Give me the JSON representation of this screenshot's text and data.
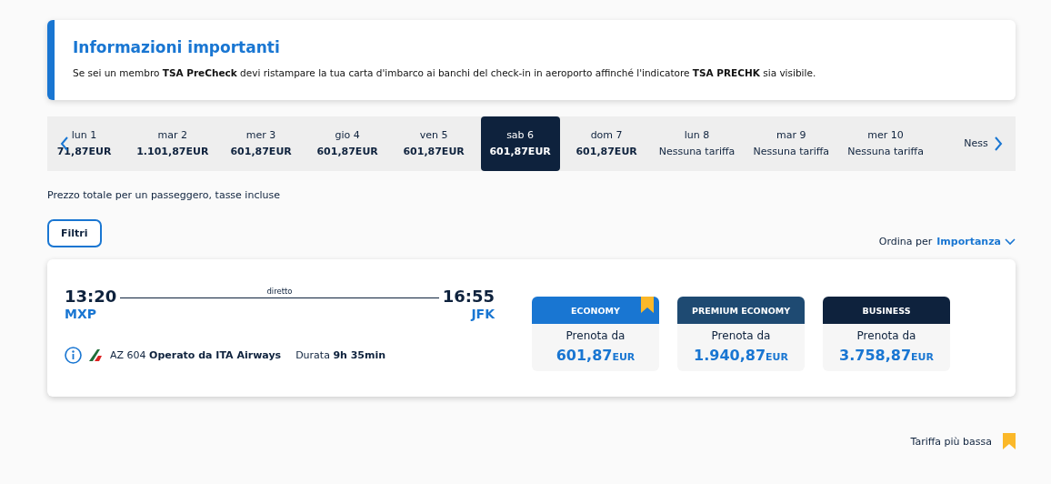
{
  "notice": {
    "title": "Informazioni importanti",
    "text": "Se sei un membro **TSA PreCheck** devi ristampare la tua carta d'imbarco ai banchi del check-in in aeroporto affinché l'indicatore **TSA PRECHK** sia visibile."
  },
  "dates": [
    {
      "day": "lun 1",
      "price": "71,87EUR",
      "kind": "fare",
      "selected": false
    },
    {
      "day": "mar 2",
      "price": "1.101,87EUR",
      "kind": "fare",
      "selected": false
    },
    {
      "day": "mer 3",
      "price": "601,87EUR",
      "kind": "fare",
      "selected": false
    },
    {
      "day": "gio 4",
      "price": "601,87EUR",
      "kind": "fare",
      "selected": false
    },
    {
      "day": "ven 5",
      "price": "601,87EUR",
      "kind": "fare",
      "selected": false
    },
    {
      "day": "sab 6",
      "price": "601,87EUR",
      "kind": "fare",
      "selected": true
    },
    {
      "day": "dom 7",
      "price": "601,87EUR",
      "kind": "fare",
      "selected": false
    },
    {
      "day": "lun 8",
      "price": "Nessuna tariffa",
      "kind": "none",
      "selected": false
    },
    {
      "day": "mar 9",
      "price": "Nessuna tariffa",
      "kind": "none",
      "selected": false
    },
    {
      "day": "mer 10",
      "price": "Nessuna tariffa",
      "kind": "none",
      "selected": false
    },
    {
      "price": "Ness",
      "kind": "none",
      "selected": false
    }
  ],
  "price_note": "Prezzo totale per un passeggero, tasse incluse",
  "filter_button": "Filtri",
  "sort": {
    "label": "Ordina per",
    "value": "Importanza"
  },
  "flight": {
    "departure_time": "13:20",
    "departure_airport": "MXP",
    "stops": "diretto",
    "arrival_time": "16:55",
    "arrival_airport": "JFK",
    "flight_number": "AZ 604 **Operato da ITA Airways**",
    "duration": "Durata **9h 35min**"
  },
  "fares": [
    {
      "cabin": "ECONOMY",
      "color": "#1976d2",
      "lowest": true,
      "label": "Prenota da",
      "amount": "601,87",
      "currency": "EUR"
    },
    {
      "cabin": "PREMIUM ECONOMY",
      "color": "#1e4a72",
      "lowest": false,
      "label": "Prenota da",
      "amount": "1.940,87",
      "currency": "EUR"
    },
    {
      "cabin": "BUSINESS",
      "color": "#0e223d",
      "lowest": false,
      "label": "Prenota da",
      "amount": "3.758,87",
      "currency": "EUR"
    }
  ],
  "legend": "Tariffa più bassa"
}
